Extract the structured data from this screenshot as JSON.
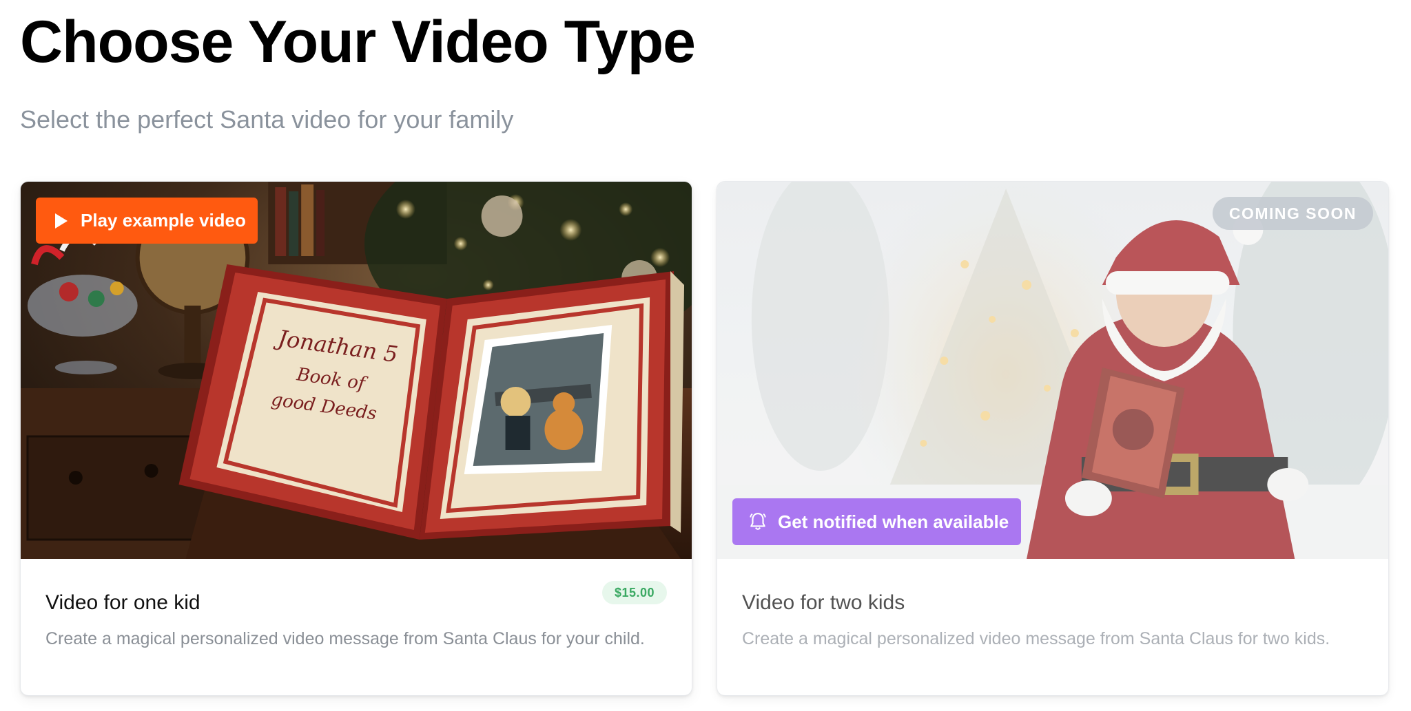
{
  "header": {
    "title": "Choose Your Video Type",
    "subtitle": "Select the perfect Santa video for your family"
  },
  "cards": [
    {
      "title": "Video for one kid",
      "price": "$15.00",
      "description": "Create a magical personalized video message from Santa Claus for your child.",
      "play_label": "Play example video",
      "image": {
        "book_line_1": "Jonathan 5",
        "book_line_2": "Book of",
        "book_line_3": "good Deeds"
      }
    },
    {
      "title": "Video for two kids",
      "badge": "COMING SOON",
      "description": "Create a magical personalized video message from Santa Claus for two kids.",
      "notify_label": "Get notified when available"
    }
  ],
  "colors": {
    "play_button": "#ff5a10",
    "notify_button": "#a36cf0",
    "price_badge_bg": "#e7f7ec",
    "price_badge_text": "#3aa962"
  },
  "icons": {
    "play": "play-icon",
    "bell": "bell-icon"
  }
}
